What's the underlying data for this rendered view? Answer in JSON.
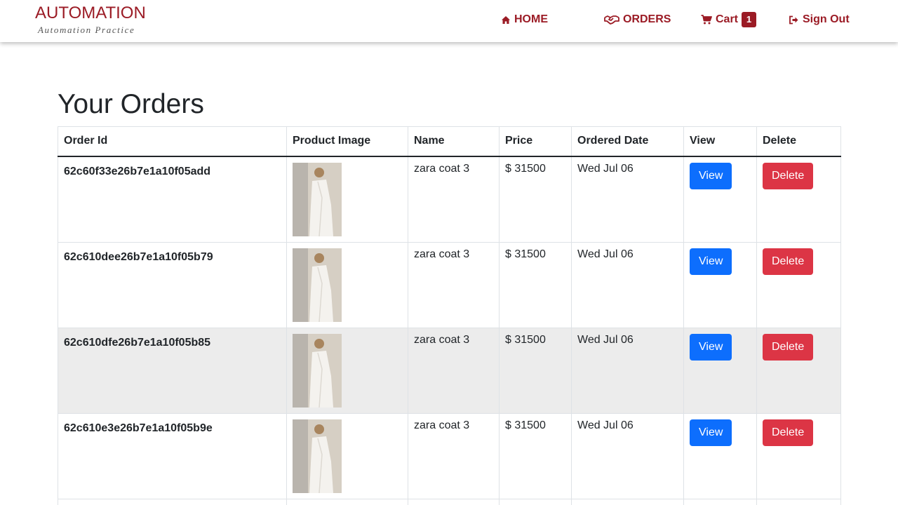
{
  "brand": {
    "title": "AUTOMATION",
    "subtitle": "Automation Practice"
  },
  "nav": {
    "home": "HOME",
    "orders": "ORDERS",
    "cart": "Cart",
    "cart_count": "1",
    "signout": "Sign Out"
  },
  "colors": {
    "brand": "#9b1b25",
    "view_button": "#0d6efd",
    "delete_button": "#dc3545",
    "highlight_row": "#ececec"
  },
  "page": {
    "title": "Your Orders"
  },
  "table": {
    "headers": [
      "Order Id",
      "Product Image",
      "Name",
      "Price",
      "Ordered Date",
      "View",
      "Delete"
    ],
    "rows": [
      {
        "order_id": "62c60f33e26b7e1a10f05add",
        "name": "zara coat 3",
        "price": "$ 31500",
        "date": "Wed Jul 06",
        "view": "View",
        "delete": "Delete"
      },
      {
        "order_id": "62c610dee26b7e1a10f05b79",
        "name": "zara coat 3",
        "price": "$ 31500",
        "date": "Wed Jul 06",
        "view": "View",
        "delete": "Delete"
      },
      {
        "order_id": "62c610dfe26b7e1a10f05b85",
        "name": "zara coat 3",
        "price": "$ 31500",
        "date": "Wed Jul 06",
        "view": "View",
        "delete": "Delete"
      },
      {
        "order_id": "62c610e3e26b7e1a10f05b9e",
        "name": "zara coat 3",
        "price": "$ 31500",
        "date": "Wed Jul 06",
        "view": "View",
        "delete": "Delete"
      }
    ]
  }
}
